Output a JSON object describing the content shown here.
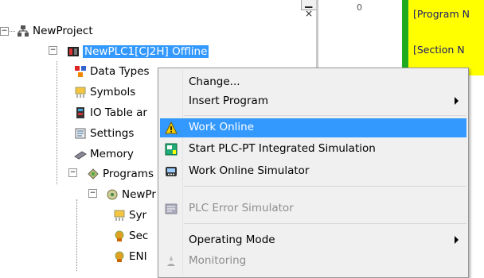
{
  "tree": {
    "root": "NewProject",
    "plc": "NewPLC1[CJ2H] Offline",
    "children": [
      "Data Types",
      "Symbols",
      "IO Table ar",
      "Settings",
      "Memory",
      "Programs"
    ],
    "program": "NewPr",
    "program_children": [
      "Syr",
      "Sec",
      "ENI"
    ]
  },
  "editor": {
    "line_number": "0",
    "program_label": "[Program N",
    "section_label": "[Section N"
  },
  "menu": {
    "change": "Change...",
    "insert_program": "Insert Program",
    "work_online": "Work Online",
    "start_sim": "Start PLC-PT Integrated Simulation",
    "work_online_sim": "Work Online Simulator",
    "plc_error_sim": "PLC Error Simulator",
    "operating_mode": "Operating Mode",
    "monitoring": "Monitoring"
  },
  "colors": {
    "selection": "#3399ff",
    "editor_green": "#1faa1f",
    "editor_yellow": "#ffff00"
  }
}
